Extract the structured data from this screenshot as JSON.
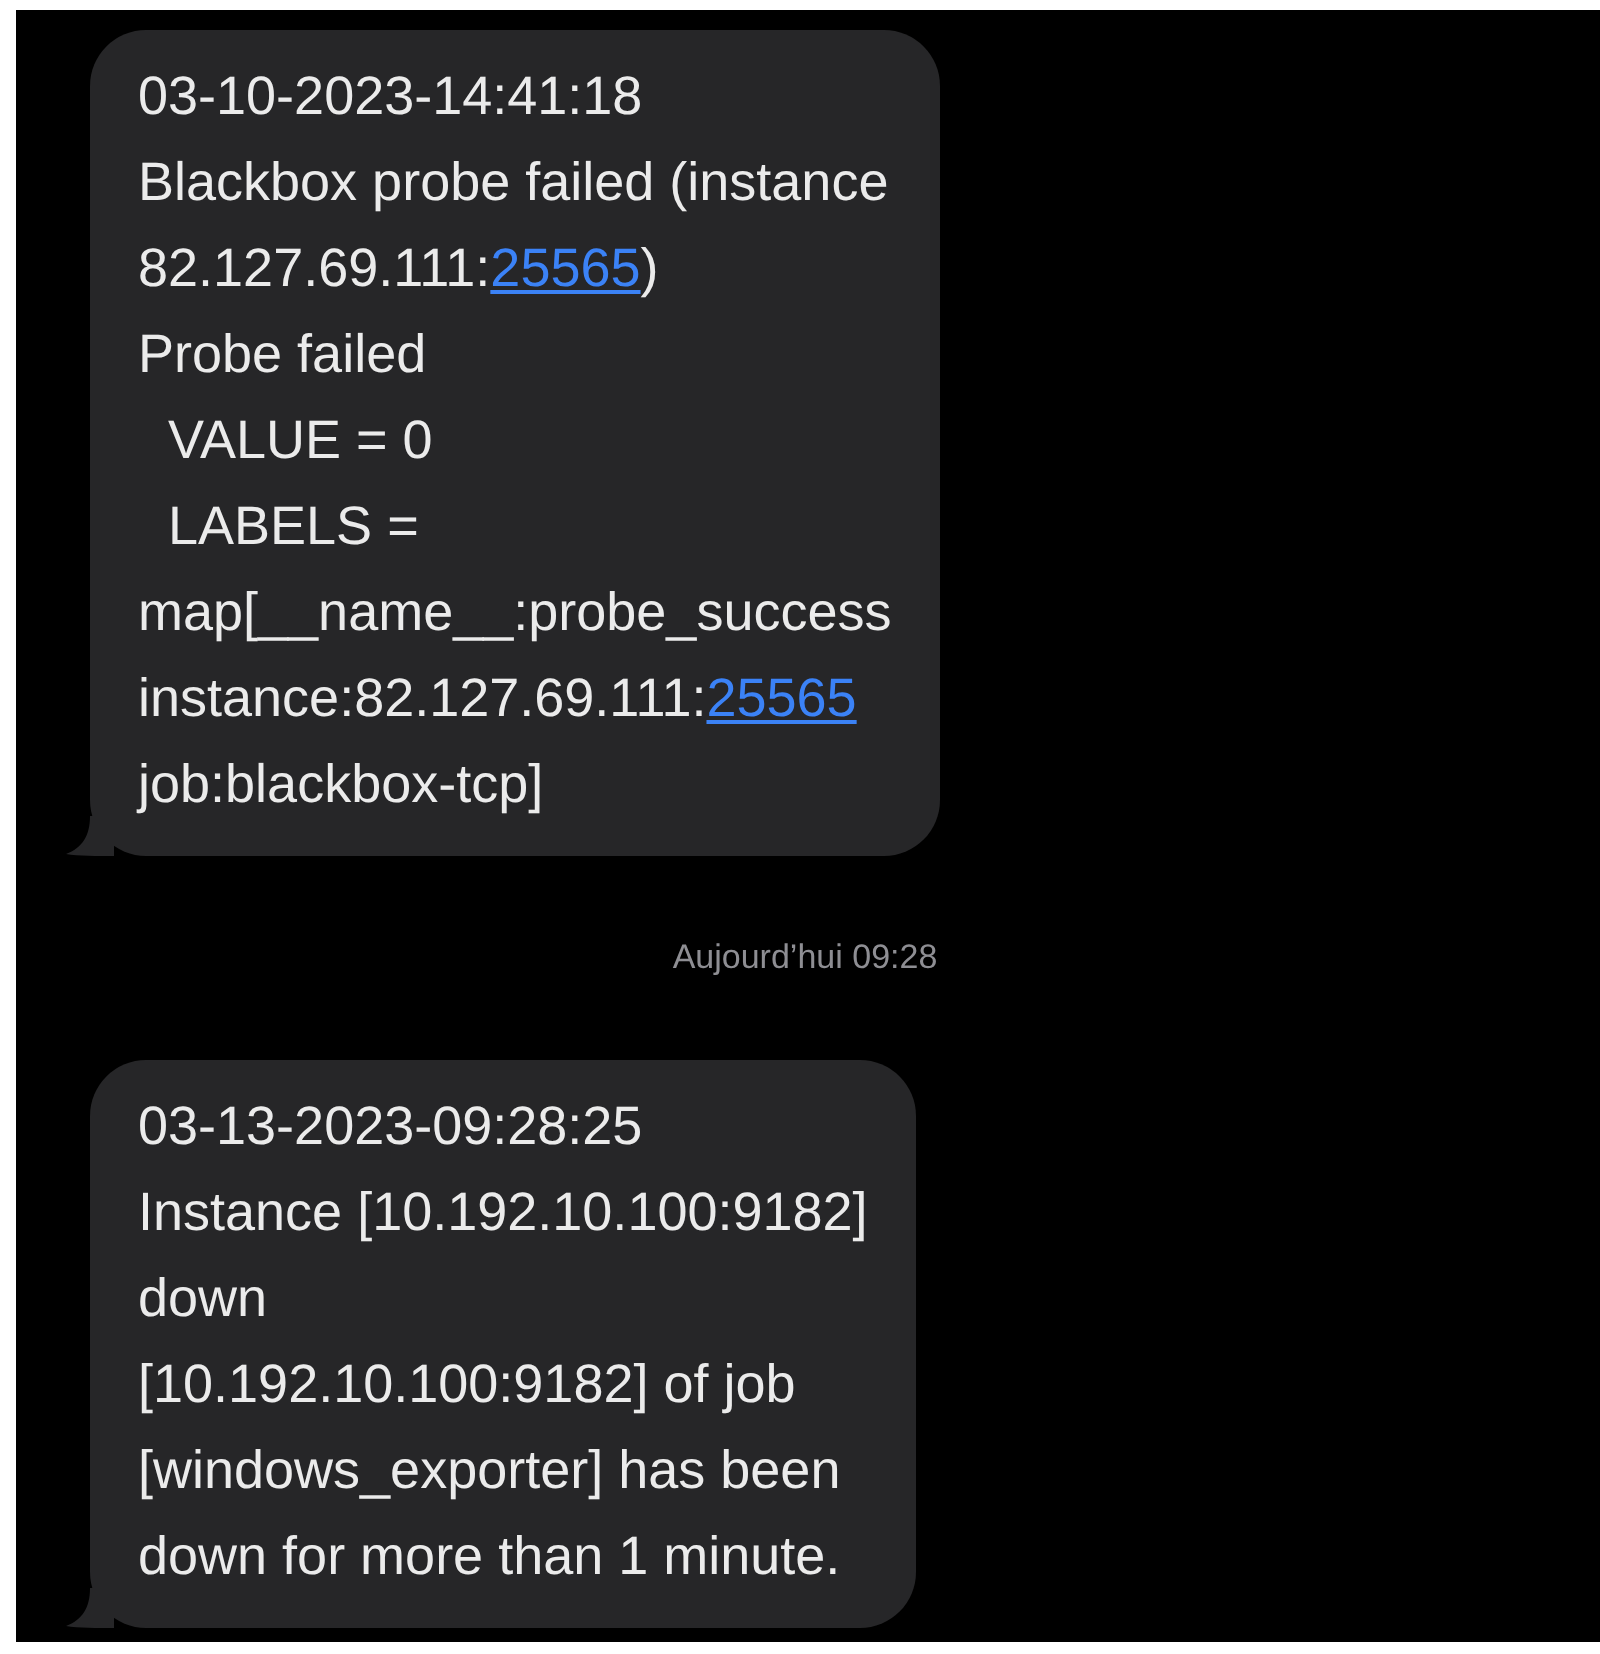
{
  "messages": [
    {
      "kind": "bubble",
      "lines": [
        [
          {
            "kind": "plain",
            "text": "03-10-2023-14:41:18"
          }
        ],
        [
          {
            "kind": "plain",
            "text": "Blackbox probe failed (instance"
          }
        ],
        [
          {
            "kind": "plain",
            "text": "82.127.69.111:"
          },
          {
            "kind": "link",
            "text": "25565"
          },
          {
            "kind": "plain",
            "text": ")"
          }
        ],
        [
          {
            "kind": "plain",
            "text": "Probe failed"
          }
        ],
        [
          {
            "kind": "plain",
            "text": "  VALUE = 0"
          }
        ],
        [
          {
            "kind": "plain",
            "text": "  LABELS ="
          }
        ],
        [
          {
            "kind": "plain",
            "text": "map[__name__:probe_success"
          }
        ],
        [
          {
            "kind": "plain",
            "text": "instance:82.127.69.111:"
          },
          {
            "kind": "link",
            "text": "25565"
          }
        ],
        [
          {
            "kind": "plain",
            "text": "job:blackbox-tcp]"
          }
        ]
      ]
    },
    {
      "kind": "timestamp",
      "text": "Aujourd’hui 09:28"
    },
    {
      "kind": "bubble",
      "lines": [
        [
          {
            "kind": "plain",
            "text": "03-13-2023-09:28:25"
          }
        ],
        [
          {
            "kind": "plain",
            "text": "Instance [10.192.10.100:9182]"
          }
        ],
        [
          {
            "kind": "plain",
            "text": "down"
          }
        ],
        [
          {
            "kind": "plain",
            "text": "[10.192.10.100:9182] of job"
          }
        ],
        [
          {
            "kind": "plain",
            "text": "[windows_exporter] has been"
          }
        ],
        [
          {
            "kind": "plain",
            "text": "down for more than 1 minute."
          }
        ]
      ]
    }
  ]
}
